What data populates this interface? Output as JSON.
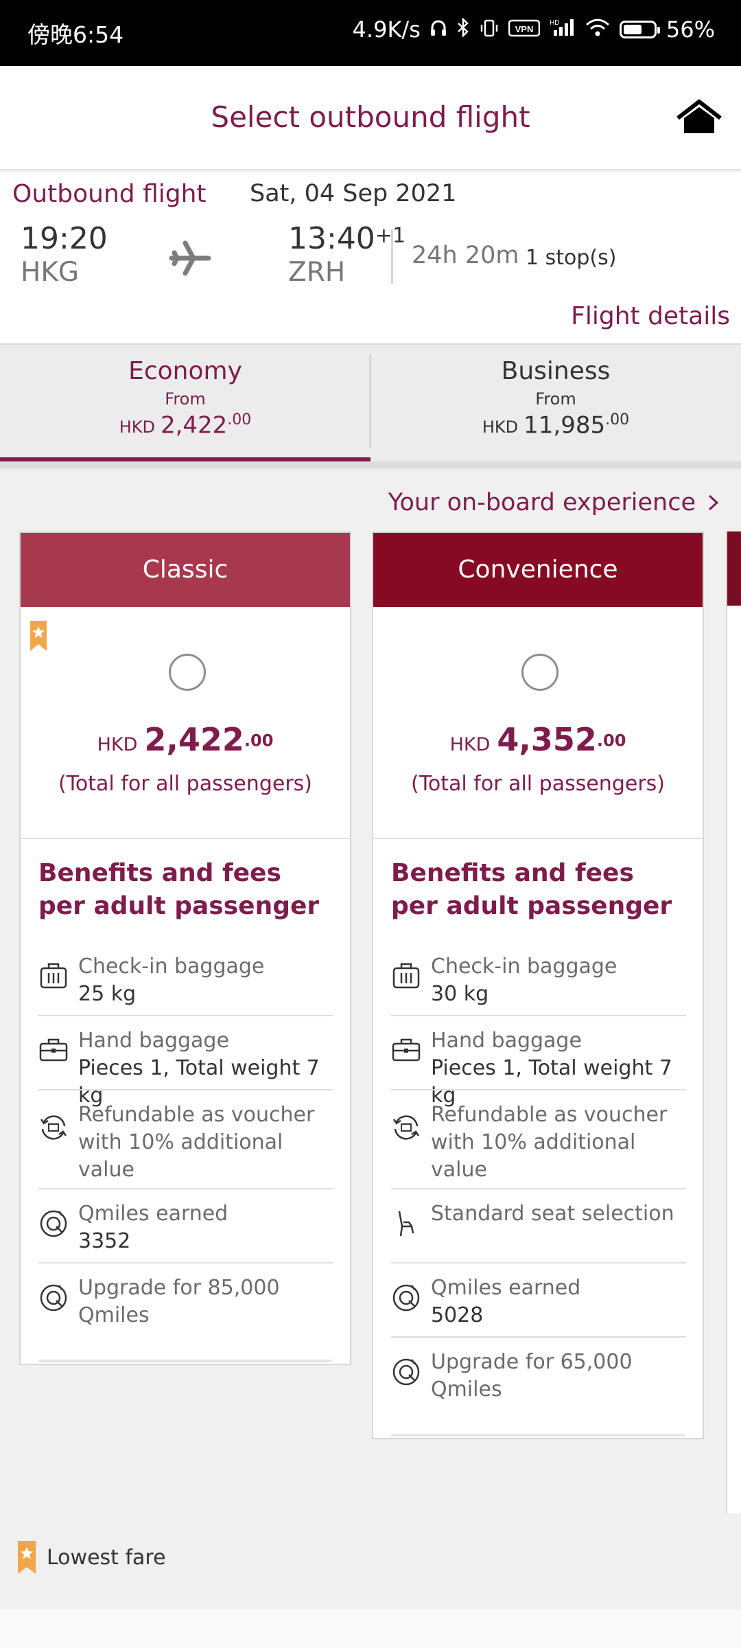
{
  "status_bar": {
    "time": "傍晚6:54",
    "net_speed": "4.9K/s",
    "battery": "56%"
  },
  "header": {
    "title": "Select outbound flight"
  },
  "flight": {
    "label": "Outbound flight",
    "date": "Sat, 04 Sep 2021",
    "dep_time": "19:20",
    "dep_code": "HKG",
    "arr_time": "13:40",
    "arr_offset": "+1",
    "arr_code": "ZRH",
    "duration": "24h 20m",
    "stops": "1 stop(s)",
    "details_link": "Flight details"
  },
  "cabins": [
    {
      "name": "Economy",
      "from": "From",
      "currency": "HKD",
      "amount": "2,422",
      "decimals": ".00",
      "selected": true
    },
    {
      "name": "Business",
      "from": "From",
      "currency": "HKD",
      "amount": "11,985",
      "decimals": ".00",
      "selected": false
    }
  ],
  "experience_link": "Your on-board experience",
  "fares": [
    {
      "name": "Classic",
      "header_color": "#a8384e",
      "currency": "HKD",
      "amount": "2,422",
      "decimals": ".00",
      "note": "(Total for all passengers)",
      "benefits_title": "Benefits and fees per adult passenger",
      "benefits": [
        {
          "icon": "luggage-icon",
          "label": "Check-in baggage",
          "value": "25 kg"
        },
        {
          "icon": "briefcase-icon",
          "label": "Hand baggage",
          "value": "Pieces 1, Total weight 7 kg"
        },
        {
          "icon": "refund-icon",
          "label": "Refundable as voucher with 10% additional value",
          "value": ""
        },
        {
          "icon": "qmiles-icon",
          "label": "Qmiles earned",
          "value": "3352"
        },
        {
          "icon": "qmiles-icon",
          "label": "Upgrade for 85,000 Qmiles",
          "value": ""
        }
      ]
    },
    {
      "name": "Convenience",
      "header_color": "#870a24",
      "currency": "HKD",
      "amount": "4,352",
      "decimals": ".00",
      "note": "(Total for all passengers)",
      "benefits_title": "Benefits and fees per adult passenger",
      "benefits": [
        {
          "icon": "luggage-icon",
          "label": "Check-in baggage",
          "value": "30 kg"
        },
        {
          "icon": "briefcase-icon",
          "label": "Hand baggage",
          "value": "Pieces 1, Total weight 7 kg"
        },
        {
          "icon": "refund-icon",
          "label": "Refundable as voucher with 10% additional value",
          "value": ""
        },
        {
          "icon": "seat-icon",
          "label": "Standard seat selection",
          "value": ""
        },
        {
          "icon": "qmiles-icon",
          "label": "Qmiles earned",
          "value": "5028"
        },
        {
          "icon": "qmiles-icon",
          "label": "Upgrade for 65,000 Qmiles",
          "value": ""
        }
      ]
    }
  ],
  "legend": {
    "label": "Lowest fare"
  },
  "colors": {
    "brand": "#7e1c4c",
    "ribbon": "#f2a64a"
  }
}
